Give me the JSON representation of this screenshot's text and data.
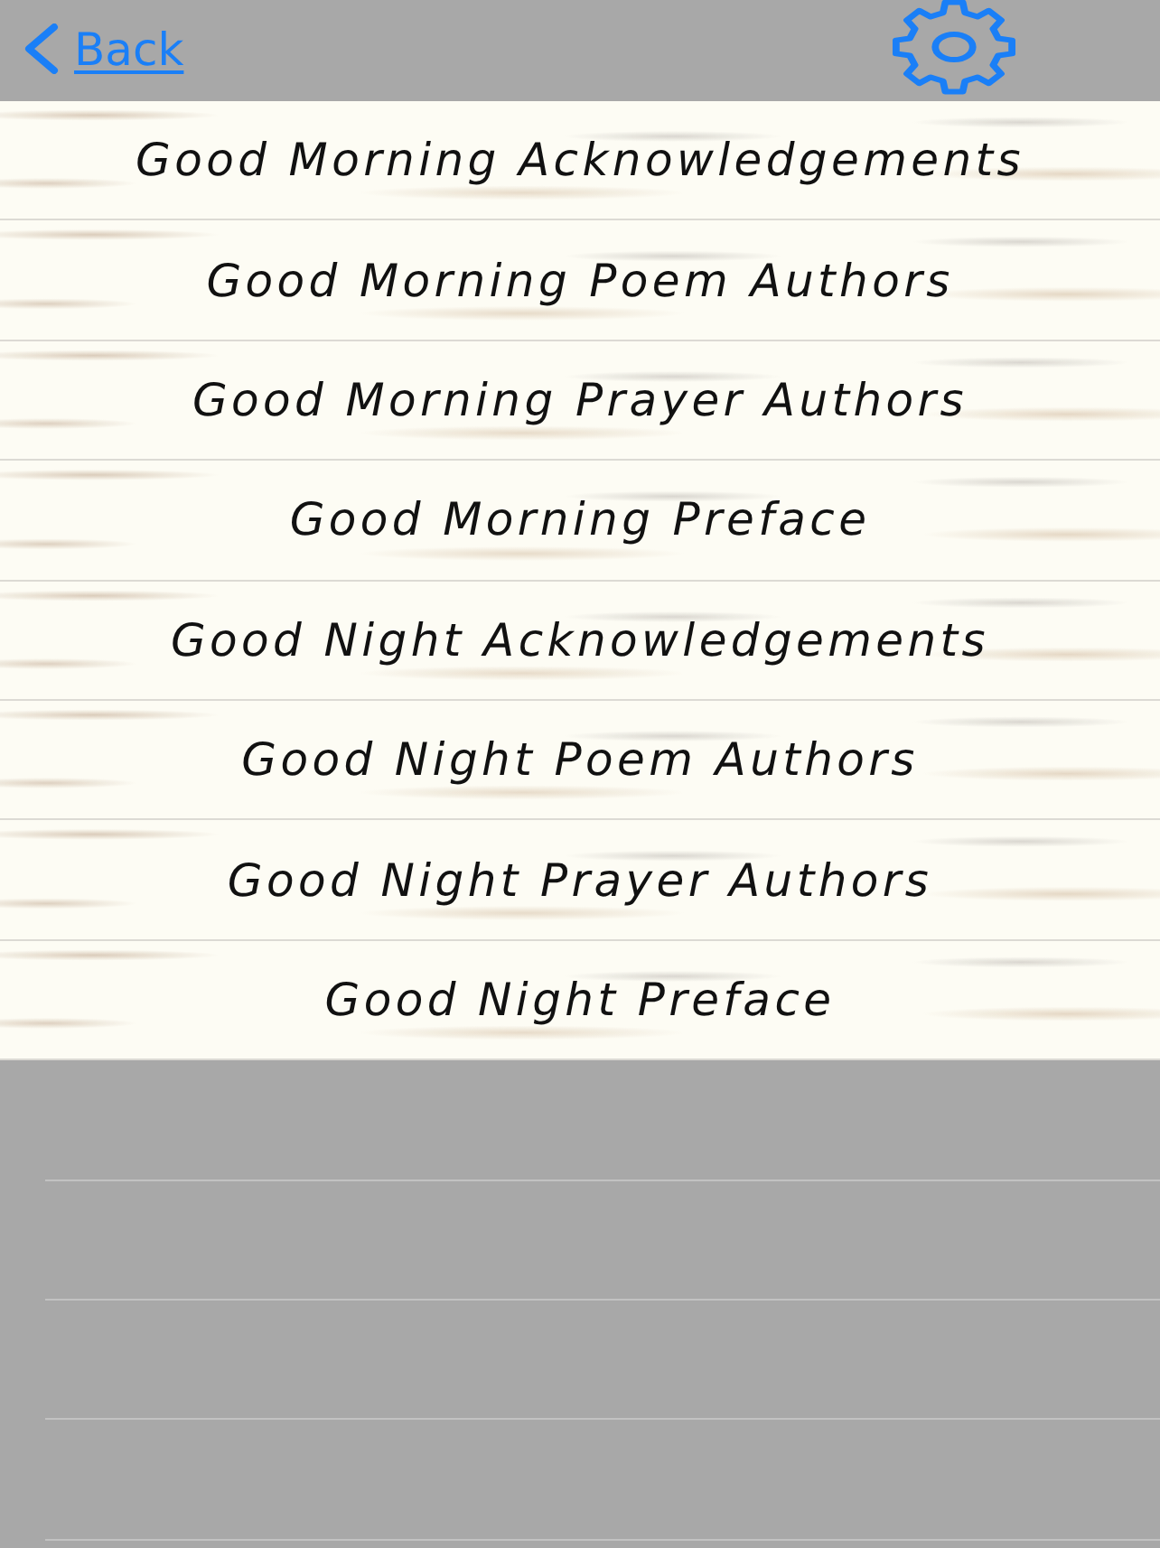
{
  "nav_bar": {
    "back_button": {
      "label": "Back"
    },
    "settings_button": {
      "kind": "gear"
    }
  },
  "list": {
    "items": [
      {
        "label": "Good Morning Acknowledgements"
      },
      {
        "label": "Good Morning Poem Authors"
      },
      {
        "label": "Good Morning Prayer Authors"
      },
      {
        "label": "Good Morning Preface"
      },
      {
        "label": "Good Night Acknowledgements"
      },
      {
        "label": "Good Night Poem Authors"
      },
      {
        "label": "Good Night Prayer Authors"
      },
      {
        "label": "Good Night Preface"
      }
    ]
  }
}
